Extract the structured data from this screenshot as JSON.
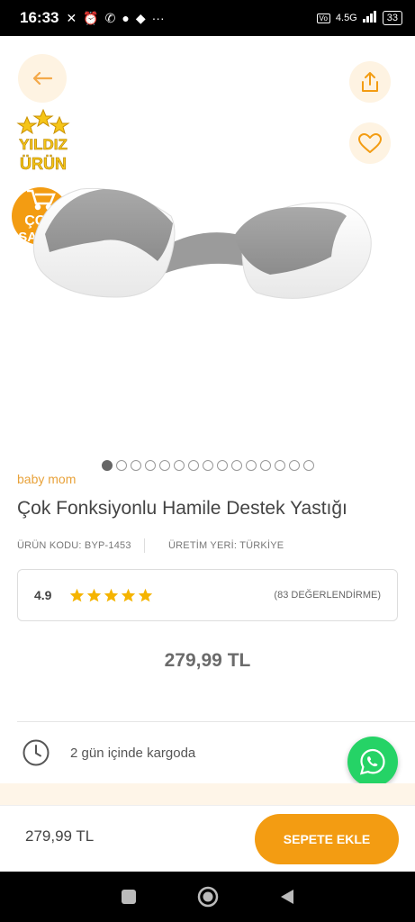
{
  "status_bar": {
    "time": "16:33",
    "network": "4.5G",
    "battery": "33",
    "more": "···"
  },
  "icons": {
    "back": "arrow-left-icon",
    "share": "share-icon",
    "favorite": "heart-icon",
    "shipping": "clock-icon",
    "whatsapp": "whatsapp-icon"
  },
  "badges": {
    "star_badge": [
      "YILDIZ",
      "ÜRÜN"
    ],
    "bestseller_badge": [
      "ÇOK",
      "SATAN"
    ]
  },
  "carousel": {
    "total": 15,
    "active_index": 0
  },
  "product": {
    "brand": "baby mom",
    "title": "Çok Fonksiyonlu Hamile Destek Yastığı",
    "code": "ÜRÜN KODU: BYP-1453",
    "origin": "ÜRETİM YERİ: TÜRKİYE",
    "rating": "4.9",
    "stars": 5,
    "rating_count": "(83 DEĞERLENDİRME)",
    "price": "279,99 TL"
  },
  "shipping": {
    "text": "2 gün içinde kargoda"
  },
  "bottom_bar": {
    "price": "279,99 TL",
    "add_to_cart": "SEPETE EKLE"
  },
  "colors": {
    "accent": "#f39c12",
    "brand_text": "#e8a23a",
    "whatsapp": "#25d366",
    "button_bg": "#fef3e2"
  }
}
